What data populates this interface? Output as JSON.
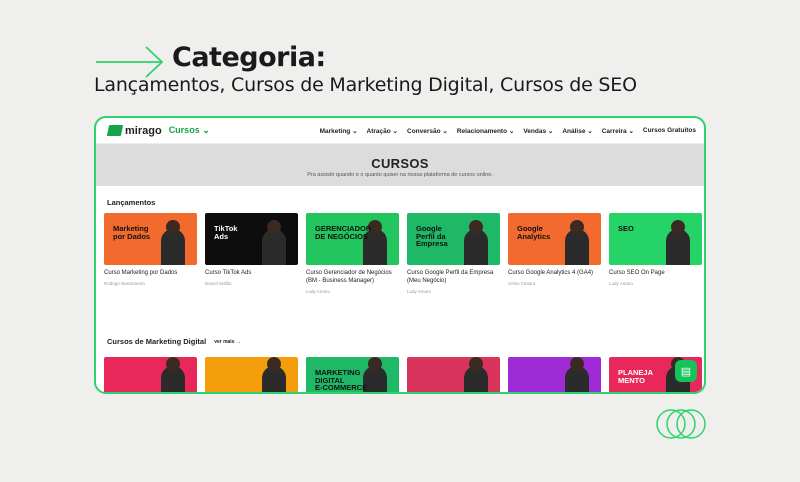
{
  "header": {
    "title": "Categoria:",
    "categories": "Lançamentos, Cursos de Marketing Digital, Cursos de SEO"
  },
  "site": {
    "logo_text": "mirago",
    "logo_section": "Cursos ⌄",
    "nav": [
      "Marketing ⌄",
      "Atração ⌄",
      "Conversão ⌄",
      "Relacionamento ⌄",
      "Vendas ⌄",
      "Análise ⌄",
      "Carreira ⌄",
      "Cursos Gratuitos"
    ]
  },
  "hero": {
    "title": "CURSOS",
    "subtitle": "Pra assistir quando e o quanto quiser na nossa plataforma de cursos online."
  },
  "sections": [
    {
      "title": "Lançamentos",
      "cards": [
        {
          "thumb_text": "Marketing\npor Dados",
          "title": "Curso Marketing por Dados",
          "author": "Rodrigo Nascimento",
          "color": "#f26a2e"
        },
        {
          "thumb_text": "TikTok\nAds",
          "title": "Curso TikTok Ads",
          "author": "Daniel Sullão",
          "color": "#0d0d0d"
        },
        {
          "thumb_text": "GERENCIADOR\nDE NEGÓCIOS",
          "title": "Curso Gerenciador de Negócios (BM - Business Manager)",
          "author": "Ludy Amaro",
          "color": "#22c55e"
        },
        {
          "thumb_text": "Google\nPerfil da\nEmpresa",
          "title": "Curso Google Perfil da Empresa (Meu Negócio)",
          "author": "Ludy Amaro",
          "color": "#1fb866"
        },
        {
          "thumb_text": "Google\nAnalytics",
          "title": "Curso Google Analytics 4 (GA4)",
          "author": "Celso Cintara",
          "color": "#f26a2e"
        },
        {
          "thumb_text": "SEO",
          "title": "Curso SEO On Page",
          "author": "Ludy Amaro",
          "color": "#25d366"
        }
      ]
    },
    {
      "title": "Cursos de Marketing Digital",
      "see_more": "ver mais →",
      "cards": [
        {
          "thumb_text": "",
          "color": "#e8285a"
        },
        {
          "thumb_text": "",
          "color": "#f59e0b"
        },
        {
          "thumb_text": "MARKETING\nDIGITAL\nE-COMMERCE",
          "color": "#1fb866"
        },
        {
          "thumb_text": "",
          "color": "#d9345b"
        },
        {
          "thumb_text": "",
          "color": "#9f2bd6"
        },
        {
          "thumb_text": "PLANEJA\nMENTO",
          "color": "#e8285a"
        }
      ]
    }
  ],
  "colors": {
    "accent": "#2fd36b",
    "brand": "#16a34a",
    "background": "#efefed"
  },
  "icons": {
    "arrow": "arrow-right-icon",
    "chat": "chat-icon",
    "rings": "rings-icon"
  }
}
